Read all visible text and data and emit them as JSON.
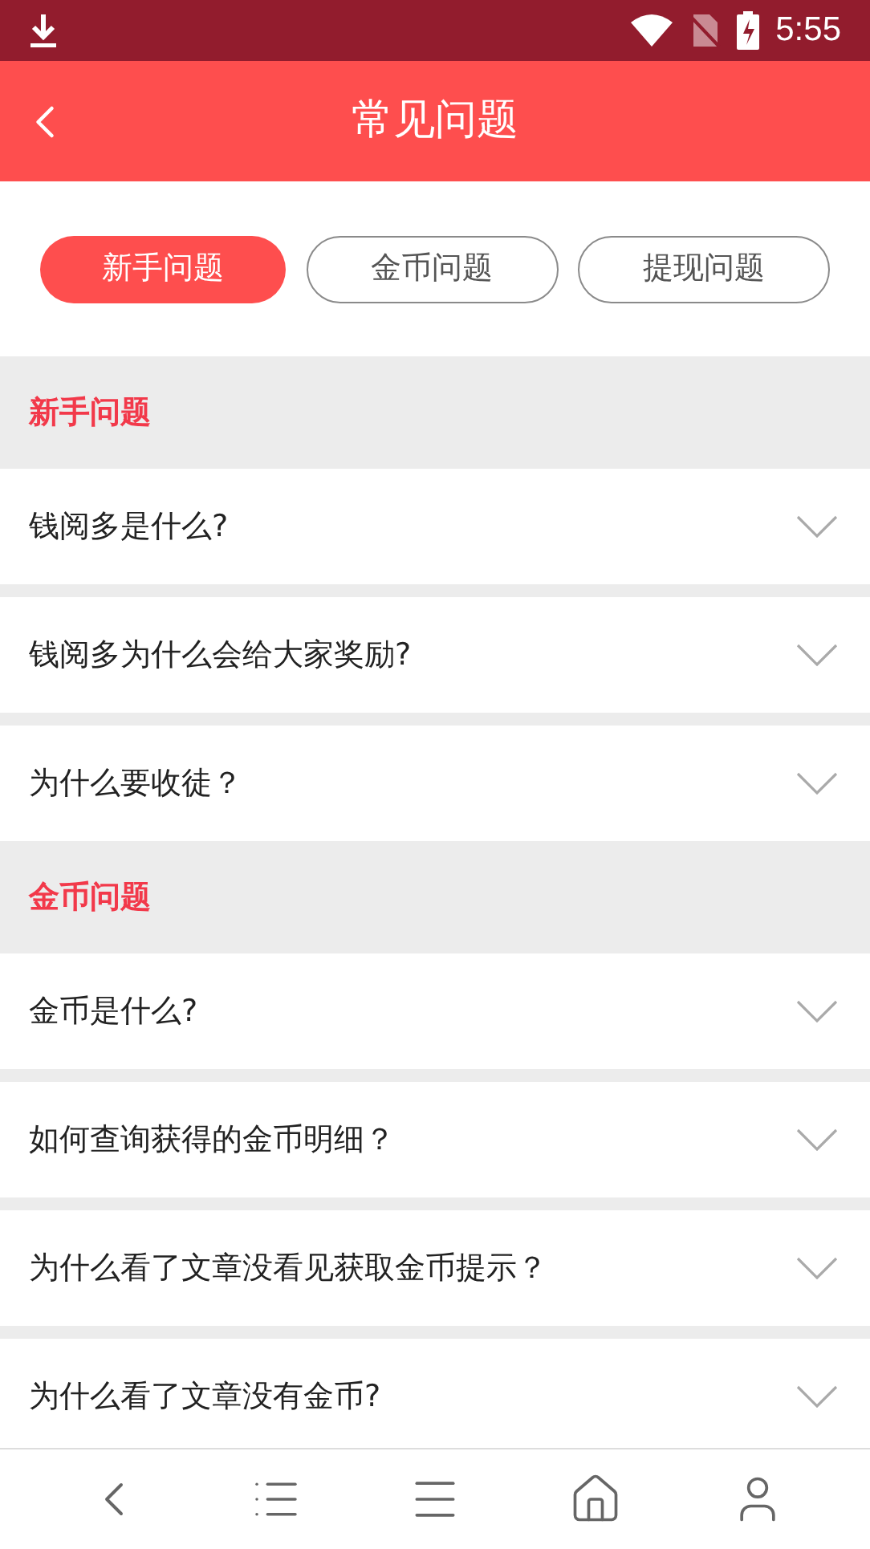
{
  "status_bar": {
    "time": "5:55"
  },
  "header": {
    "title": "常见问题"
  },
  "tabs": [
    {
      "label": "新手问题",
      "selected": true
    },
    {
      "label": "金币问题",
      "selected": false
    },
    {
      "label": "提现问题",
      "selected": false
    }
  ],
  "sections": [
    {
      "title": "新手问题",
      "questions": [
        {
          "text": "钱阅多是什么?",
          "expanded": false
        },
        {
          "text": "钱阅多为什么会给大家奖励?",
          "expanded": false
        },
        {
          "text": "为什么要收徒？",
          "expanded": false
        }
      ]
    },
    {
      "title": "金币问题",
      "questions": [
        {
          "text": "金币是什么?",
          "expanded": false
        },
        {
          "text": "如何查询获得的金币明细？",
          "expanded": false
        },
        {
          "text": "为什么看了文章没看见获取金币提示？",
          "expanded": false
        },
        {
          "text": "为什么看了文章没有金币?",
          "expanded": false
        }
      ]
    }
  ]
}
